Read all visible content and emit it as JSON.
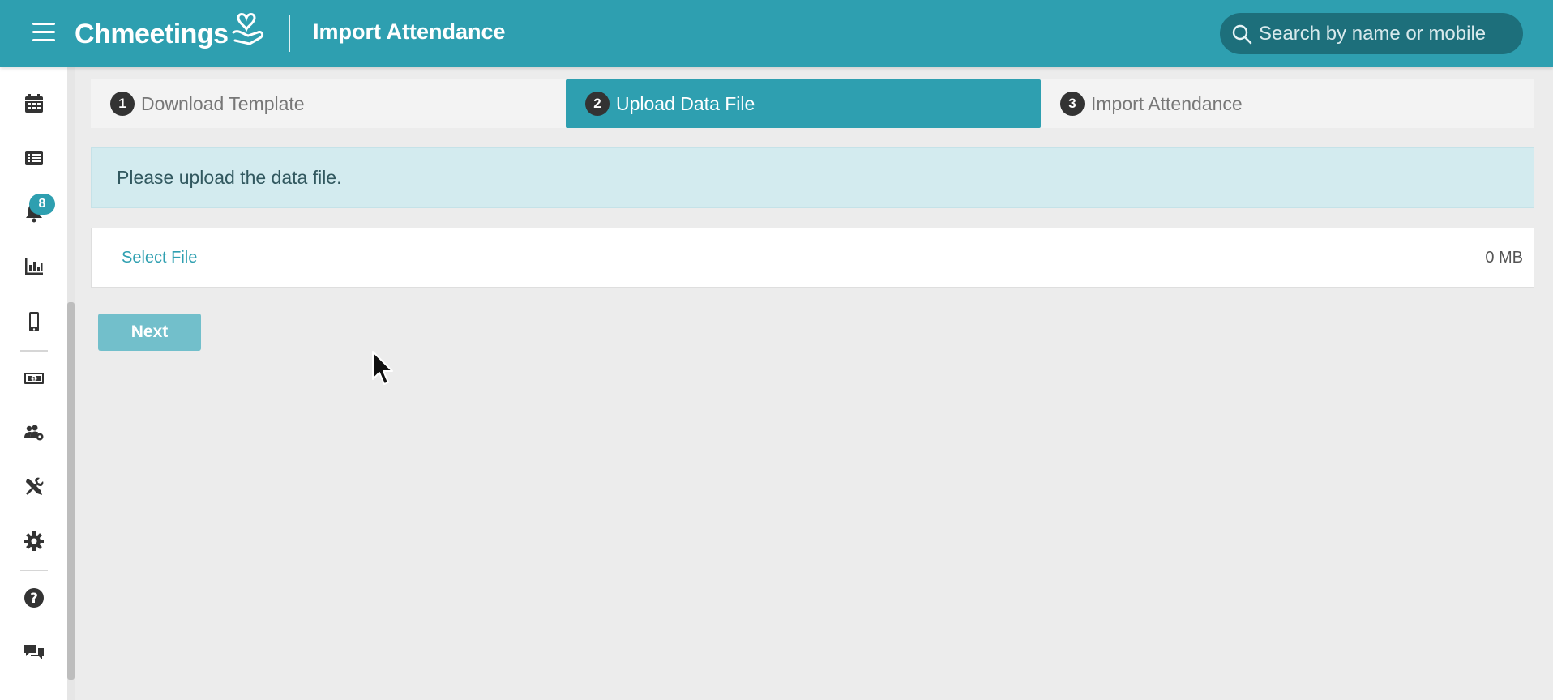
{
  "header": {
    "brand": "Chmeetings",
    "title": "Import Attendance",
    "search_placeholder": "Search by name or mobile"
  },
  "sidebar": {
    "notification_count": "8",
    "items": [
      {
        "icon": "calendar-icon"
      },
      {
        "icon": "list-icon"
      },
      {
        "icon": "bell-icon"
      },
      {
        "icon": "bar-chart-icon"
      },
      {
        "icon": "mobile-icon"
      },
      {
        "icon": "money-icon"
      },
      {
        "icon": "group-settings-icon"
      },
      {
        "icon": "tools-icon"
      },
      {
        "icon": "gear-icon"
      },
      {
        "icon": "help-icon"
      },
      {
        "icon": "chat-icon"
      }
    ]
  },
  "steps": [
    {
      "number": "1",
      "label": "Download Template",
      "active": false
    },
    {
      "number": "2",
      "label": "Upload Data File",
      "active": true
    },
    {
      "number": "3",
      "label": "Import Attendance",
      "active": false
    }
  ],
  "alert": {
    "text": "Please upload the data file."
  },
  "file": {
    "select_label": "Select File",
    "size": "0 MB"
  },
  "actions": {
    "next_label": "Next"
  },
  "colors": {
    "primary": "#2e9fb0",
    "search_bg": "#1d6f7b",
    "button_disabled": "#72bfcb"
  }
}
